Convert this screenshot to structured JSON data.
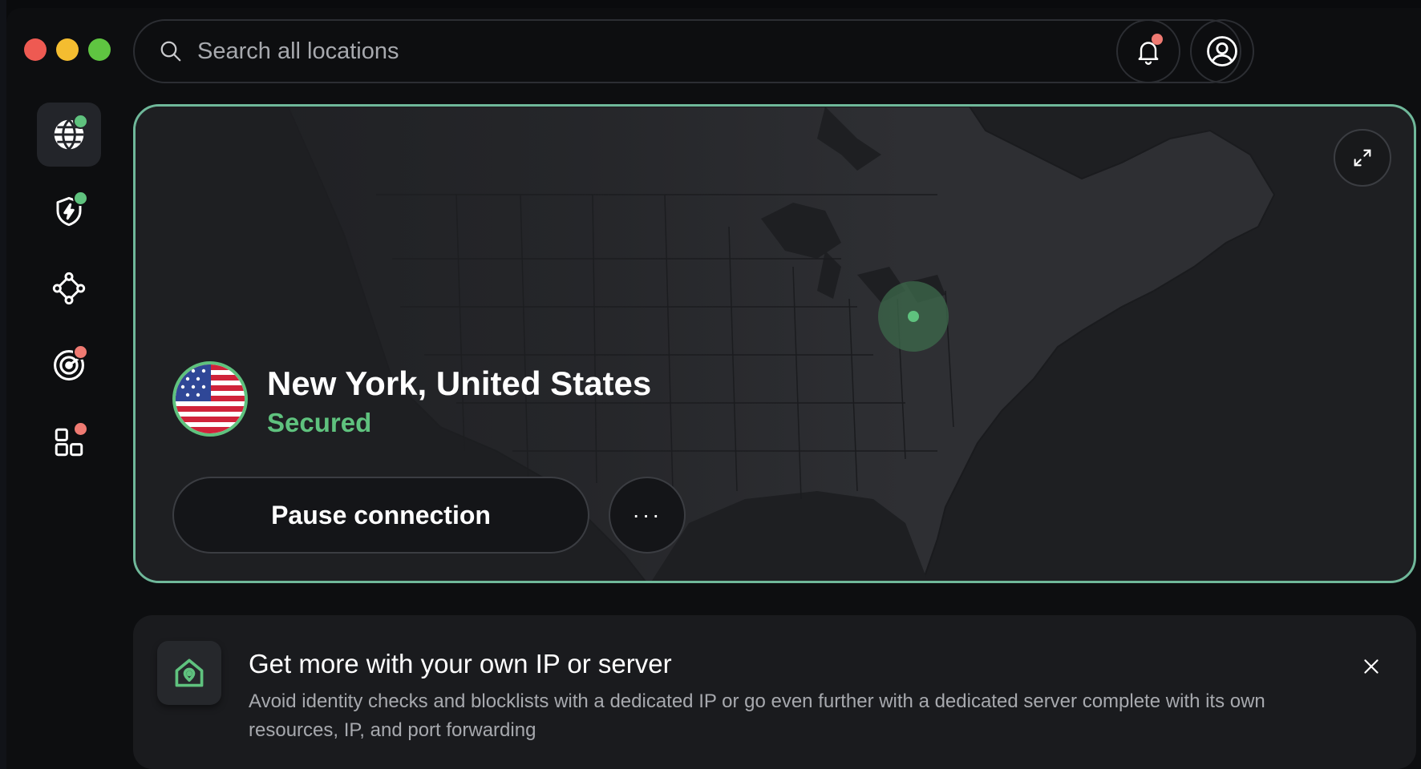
{
  "window": {
    "controls": [
      "close",
      "minimize",
      "zoom"
    ]
  },
  "search": {
    "placeholder": "Search all locations",
    "icon": "search-icon"
  },
  "header": {
    "notifications_icon": "bell-icon",
    "account_icon": "user-circle-icon"
  },
  "sidebar": {
    "items": [
      {
        "id": "locations",
        "icon": "globe-icon",
        "active": true,
        "badge": "green"
      },
      {
        "id": "threat-protection",
        "icon": "shield-bolt-icon",
        "active": false,
        "badge": "green"
      },
      {
        "id": "meshnet",
        "icon": "mesh-network-icon",
        "active": false,
        "badge": null
      },
      {
        "id": "dark-web-monitor",
        "icon": "radar-icon",
        "active": false,
        "badge": "red"
      },
      {
        "id": "apps",
        "icon": "grid-apps-icon",
        "active": false,
        "badge": "red"
      }
    ]
  },
  "connection": {
    "location": "New York, United States",
    "status": "Secured",
    "flag_icon": "us-flag-icon",
    "pause_label": "Pause connection",
    "more_label": "···",
    "expand_icon": "expand-icon"
  },
  "banner": {
    "icon": "home-pin-icon",
    "title": "Get more with your own IP or server",
    "description": "Avoid identity checks and blocklists with a dedicated IP or go even further with a dedicated server complete with its own resources, IP, and port forwarding",
    "close_icon": "close-icon"
  },
  "colors": {
    "accent_green": "#5fc27e",
    "card_border": "#6fb89a",
    "badge_red": "#ef7a72",
    "badge_green": "#5fc27e"
  }
}
